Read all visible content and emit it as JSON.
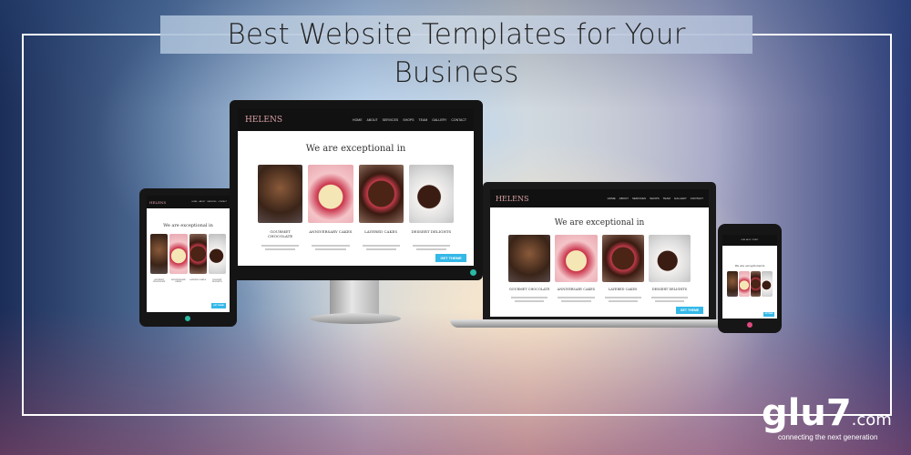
{
  "banner": {
    "title": "Best Website Templates for Your Business",
    "logo_main": "glu7",
    "logo_suffix": ".com",
    "logo_tagline": "connecting the next generation"
  },
  "site": {
    "brand": "HELENS",
    "nav": [
      "HOME",
      "ABOUT",
      "SERVICES",
      "SHOPS",
      "TEAM",
      "GALLERY",
      "CONTACT"
    ],
    "heading": "We are exceptional in",
    "cards": [
      {
        "title": "GOURMET CHOCOLATE",
        "image": "chocolate-cake-image"
      },
      {
        "title": "ANNIVERSARY CAKES",
        "image": "anniversary-cake-image"
      },
      {
        "title": "LAYERED CAKES",
        "image": "layered-cake-image"
      },
      {
        "title": "DESSERT DELIGHTS",
        "image": "dessert-image"
      }
    ],
    "button": "GET THEME"
  },
  "colors": {
    "accent": "#34b8e8",
    "nav_bg": "#111111",
    "brand": "#d9a0a6"
  }
}
